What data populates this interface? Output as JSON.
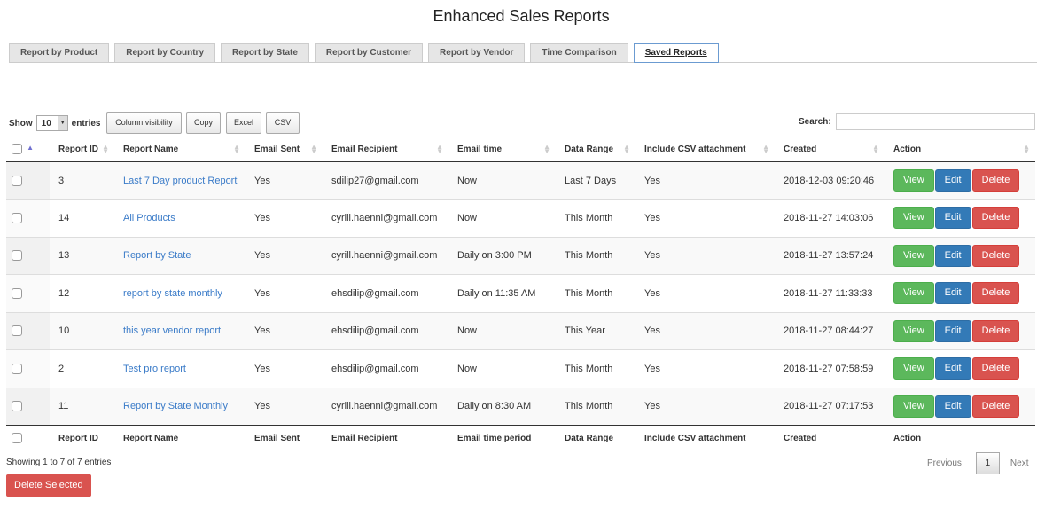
{
  "title": "Enhanced Sales Reports",
  "tabs": [
    "Report by Product",
    "Report by Country",
    "Report by State",
    "Report by Customer",
    "Report by Vendor",
    "Time Comparison",
    "Saved Reports"
  ],
  "controls": {
    "show": "Show",
    "entries_value": "10",
    "entries": "entries",
    "column_visibility": "Column visibility",
    "copy": "Copy",
    "excel": "Excel",
    "csv": "CSV",
    "search_label": "Search:",
    "search_value": ""
  },
  "columns": [
    "Report ID",
    "Report Name",
    "Email Sent",
    "Email Recipient",
    "Email time",
    "Data Range",
    "Include CSV attachment",
    "Created",
    "Action"
  ],
  "footer_columns": [
    "Report ID",
    "Report Name",
    "Email Sent",
    "Email Recipient",
    "Email time period",
    "Data Range",
    "Include CSV attachment",
    "Created",
    "Action"
  ],
  "rows": [
    {
      "id": "3",
      "name": "Last 7 Day product Report",
      "sent": "Yes",
      "recipient": "sdilip27@gmail.com",
      "time": "Now",
      "range": "Last 7 Days",
      "csv": "Yes",
      "created": "2018-12-03 09:20:46"
    },
    {
      "id": "14",
      "name": "All Products",
      "sent": "Yes",
      "recipient": "cyrill.haenni@gmail.com",
      "time": "Now",
      "range": "This Month",
      "csv": "Yes",
      "created": "2018-11-27 14:03:06"
    },
    {
      "id": "13",
      "name": "Report by State",
      "sent": "Yes",
      "recipient": "cyrill.haenni@gmail.com",
      "time": "Daily on 3:00 PM",
      "range": "This Month",
      "csv": "Yes",
      "created": "2018-11-27 13:57:24"
    },
    {
      "id": "12",
      "name": "report by state monthly",
      "sent": "Yes",
      "recipient": "ehsdilip@gmail.com",
      "time": "Daily on 11:35 AM",
      "range": "This Month",
      "csv": "Yes",
      "created": "2018-11-27 11:33:33"
    },
    {
      "id": "10",
      "name": "this year vendor report",
      "sent": "Yes",
      "recipient": "ehsdilip@gmail.com",
      "time": "Now",
      "range": "This Year",
      "csv": "Yes",
      "created": "2018-11-27 08:44:27"
    },
    {
      "id": "2",
      "name": "Test pro report",
      "sent": "Yes",
      "recipient": "ehsdilip@gmail.com",
      "time": "Now",
      "range": "This Month",
      "csv": "Yes",
      "created": "2018-11-27 07:58:59"
    },
    {
      "id": "11",
      "name": "Report by State Monthly",
      "sent": "Yes",
      "recipient": "cyrill.haenni@gmail.com",
      "time": "Daily on 8:30 AM",
      "range": "This Month",
      "csv": "Yes",
      "created": "2018-11-27 07:17:53"
    }
  ],
  "actions": {
    "view": "View",
    "edit": "Edit",
    "delete": "Delete"
  },
  "info": "Showing 1 to 7 of 7 entries",
  "pagination": {
    "previous": "Previous",
    "page": "1",
    "next": "Next"
  },
  "delete_selected": "Delete Selected"
}
